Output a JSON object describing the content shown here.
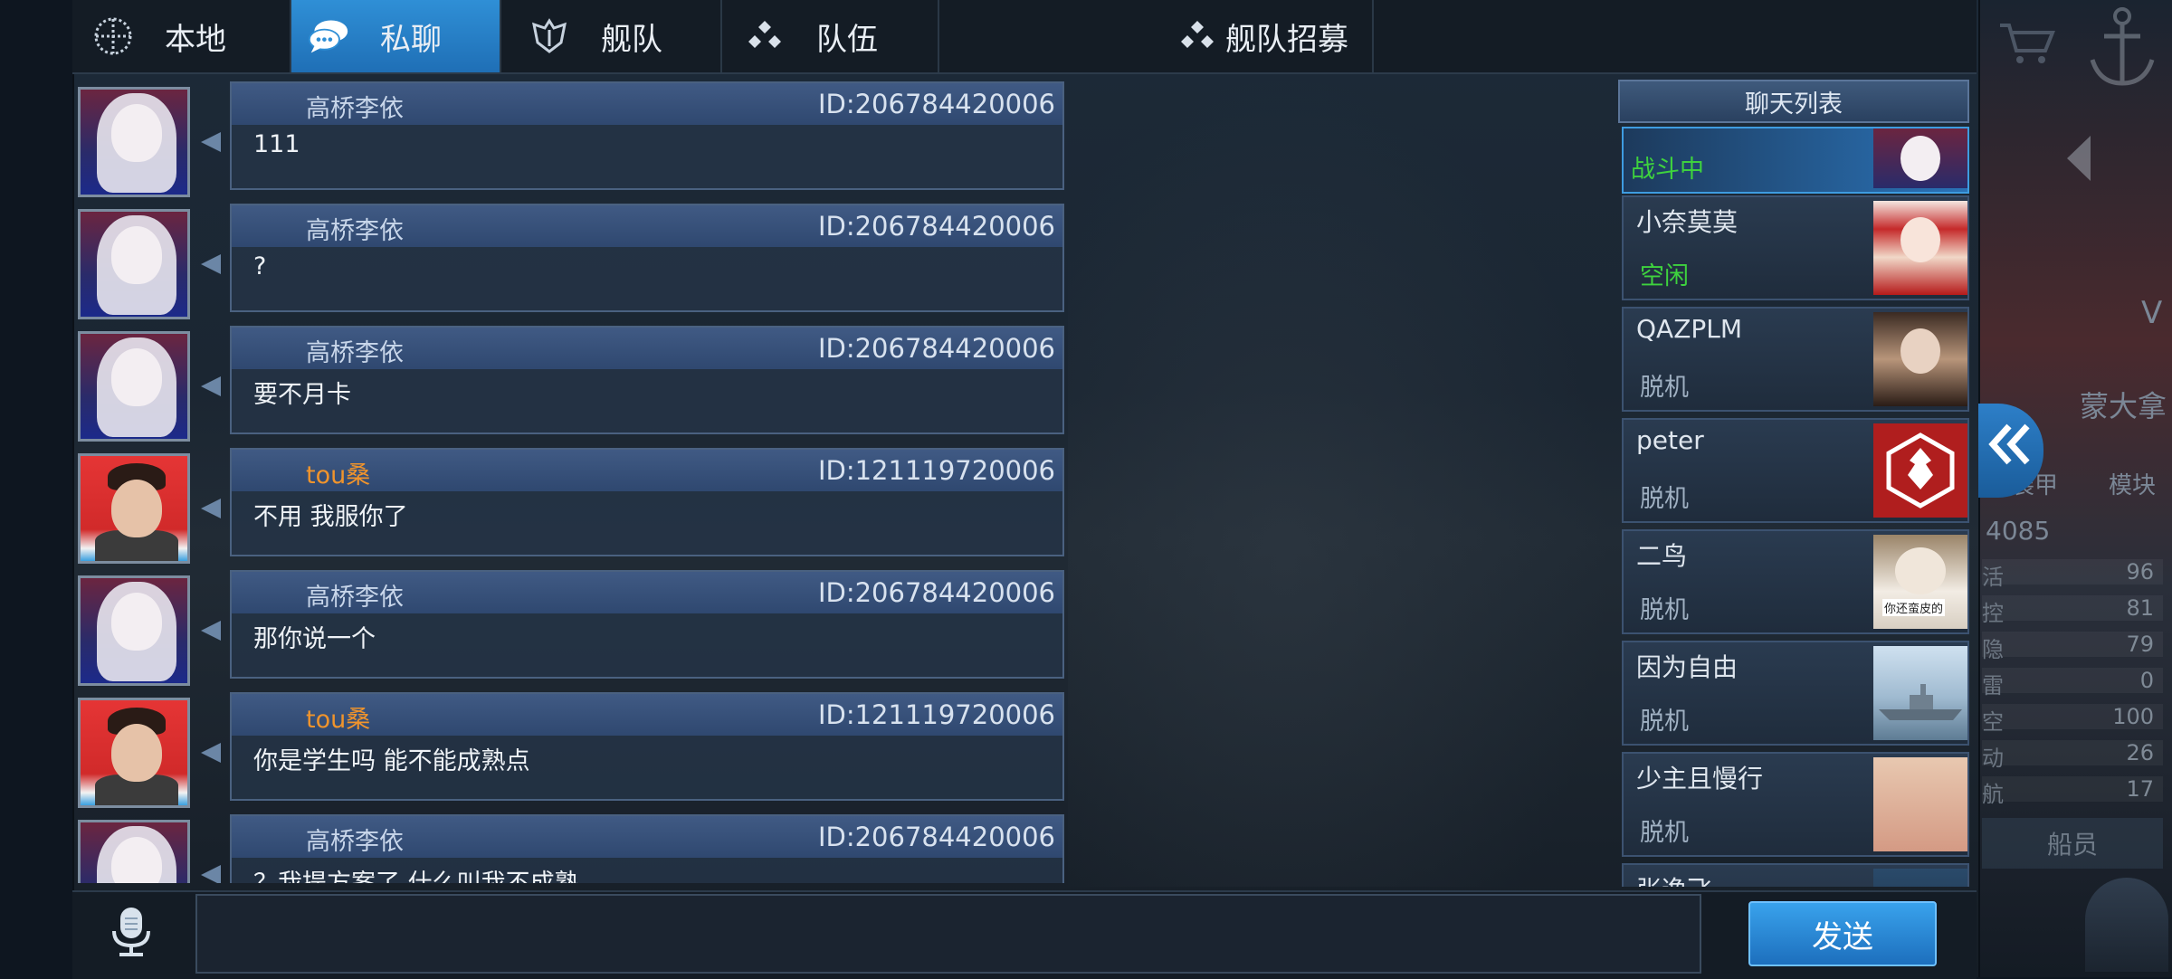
{
  "tabs": [
    {
      "label": "本地",
      "icon": "globe-icon"
    },
    {
      "label": "私聊",
      "icon": "chat-bubble-icon"
    },
    {
      "label": "舰队",
      "icon": "fleet-icon"
    },
    {
      "label": "队伍",
      "icon": "team-icon"
    },
    {
      "label": "舰队招募",
      "icon": "recruit-icon"
    }
  ],
  "active_tab": "私聊",
  "messages": [
    {
      "sender": "高桥李依",
      "id": "ID:206784420006",
      "text": "111",
      "sender_color": "#c8d6ea"
    },
    {
      "sender": "高桥李依",
      "id": "ID:206784420006",
      "text": "?",
      "sender_color": "#c8d6ea"
    },
    {
      "sender": "高桥李依",
      "id": "ID:206784420006",
      "text": "要不月卡",
      "sender_color": "#c8d6ea"
    },
    {
      "sender": "tou桑",
      "id": "ID:121119720006",
      "text": "不用 我服你了",
      "sender_color": "#f0942c"
    },
    {
      "sender": "高桥李依",
      "id": "ID:206784420006",
      "text": "那你说一个",
      "sender_color": "#c8d6ea"
    },
    {
      "sender": "tou桑",
      "id": "ID:121119720006",
      "text": "你是学生吗 能不能成熟点",
      "sender_color": "#f0942c"
    },
    {
      "sender": "高桥李依",
      "id": "ID:206784420006",
      "text": "？我提方案了 什么叫我不成熟",
      "sender_color": "#c8d6ea"
    }
  ],
  "chat_list": {
    "title": "聊天列表",
    "contacts": [
      {
        "name": "",
        "status": "战斗中",
        "avatar": "anime-white-hair"
      },
      {
        "name": "小奈莫莫",
        "status": "空闲",
        "avatar": "anime-red"
      },
      {
        "name": "QAZPLM",
        "status": "脱机",
        "avatar": "anime-fox"
      },
      {
        "name": "peter",
        "status": "脱机",
        "avatar": "red-emblem"
      },
      {
        "name": "二鸟",
        "status": "脱机",
        "avatar": "cat",
        "avatar_caption": "你还蛮皮的"
      },
      {
        "name": "因为自由",
        "status": "脱机",
        "avatar": "warship"
      },
      {
        "name": "少主且慢行",
        "status": "脱机",
        "avatar": "pink"
      },
      {
        "name": "张逸飞",
        "status": "",
        "avatar": "blue"
      }
    ]
  },
  "input": {
    "value": "",
    "placeholder": ""
  },
  "send_label": "发送",
  "side": {
    "player_name": "蒙大拿",
    "letter": "V",
    "btn_1": "装甲",
    "btn_2": "模块",
    "power": "4085",
    "stats": [
      {
        "label": "活",
        "value": "96"
      },
      {
        "label": "控",
        "value": "81"
      },
      {
        "label": "隐",
        "value": "79"
      },
      {
        "label": "雷",
        "value": "0"
      },
      {
        "label": "空",
        "value": "100"
      },
      {
        "label": "动",
        "value": "26"
      },
      {
        "label": "航",
        "value": "17"
      }
    ],
    "crew_label": "船员"
  }
}
